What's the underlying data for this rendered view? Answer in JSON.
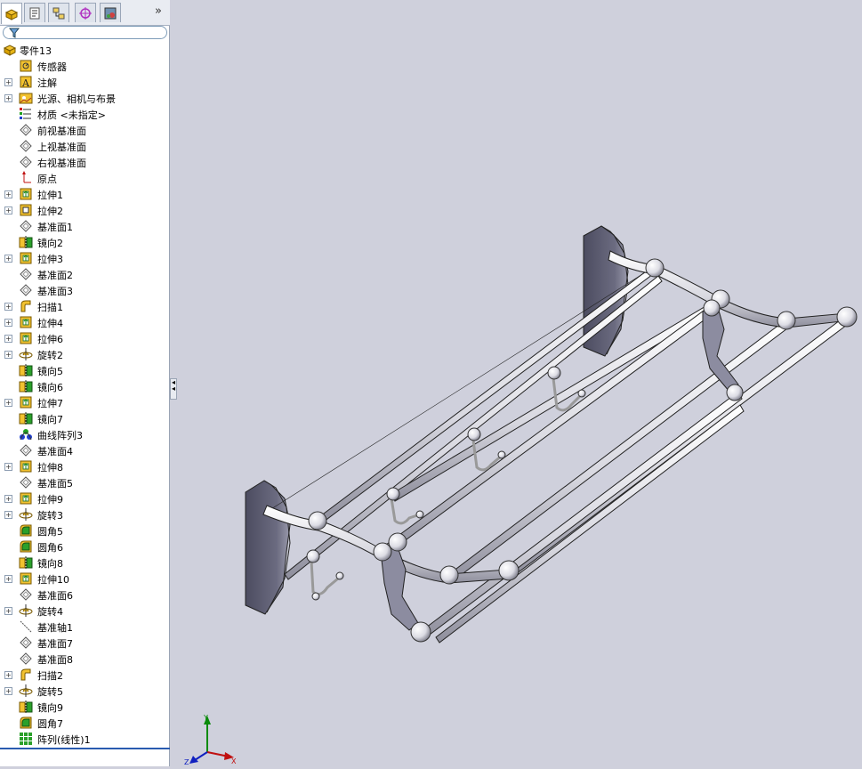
{
  "panel": {
    "tabs": [
      {
        "name": "feature-manager-tab",
        "icon": "feature-tree-icon",
        "active": true
      },
      {
        "name": "property-manager-tab",
        "icon": "property-icon",
        "active": false
      },
      {
        "name": "configuration-manager-tab",
        "icon": "configuration-icon",
        "active": false
      },
      {
        "name": "dim-xpert-tab",
        "icon": "target-icon",
        "active": false
      },
      {
        "name": "display-manager-tab",
        "icon": "display-icon",
        "active": false
      }
    ],
    "more": "»",
    "filter_icon": "filter-icon"
  },
  "tree": {
    "root": {
      "label": "零件13",
      "icon": "part-icon"
    },
    "items": [
      {
        "label": "传感器",
        "icon": "sensor-icon",
        "expandable": false
      },
      {
        "label": "注解",
        "icon": "annotation-icon",
        "expandable": true
      },
      {
        "label": "光源、相机与布景",
        "icon": "lights-icon",
        "expandable": true
      },
      {
        "label": "材质 <未指定>",
        "icon": "material-icon",
        "expandable": false
      },
      {
        "label": "前视基准面",
        "icon": "plane-icon",
        "expandable": false
      },
      {
        "label": "上视基准面",
        "icon": "plane-icon",
        "expandable": false
      },
      {
        "label": "右视基准面",
        "icon": "plane-icon",
        "expandable": false
      },
      {
        "label": "原点",
        "icon": "origin-icon",
        "expandable": false
      },
      {
        "label": "拉伸1",
        "icon": "extrude-icon",
        "expandable": true
      },
      {
        "label": "拉伸2",
        "icon": "extrude-cut-icon",
        "expandable": true
      },
      {
        "label": "基准面1",
        "icon": "plane-icon",
        "expandable": false
      },
      {
        "label": "镜向2",
        "icon": "mirror-icon",
        "expandable": false
      },
      {
        "label": "拉伸3",
        "icon": "extrude-icon",
        "expandable": true
      },
      {
        "label": "基准面2",
        "icon": "plane-icon",
        "expandable": false
      },
      {
        "label": "基准面3",
        "icon": "plane-icon",
        "expandable": false
      },
      {
        "label": "扫描1",
        "icon": "sweep-icon",
        "expandable": true
      },
      {
        "label": "拉伸4",
        "icon": "extrude-icon",
        "expandable": true
      },
      {
        "label": "拉伸6",
        "icon": "extrude-icon",
        "expandable": true
      },
      {
        "label": "旋转2",
        "icon": "revolve-icon",
        "expandable": true
      },
      {
        "label": "镜向5",
        "icon": "mirror-icon",
        "expandable": false
      },
      {
        "label": "镜向6",
        "icon": "mirror-icon",
        "expandable": false
      },
      {
        "label": "拉伸7",
        "icon": "extrude-icon",
        "expandable": true
      },
      {
        "label": "镜向7",
        "icon": "mirror-icon",
        "expandable": false
      },
      {
        "label": "曲线阵列3",
        "icon": "curve-pattern-icon",
        "expandable": false
      },
      {
        "label": "基准面4",
        "icon": "plane-icon",
        "expandable": false
      },
      {
        "label": "拉伸8",
        "icon": "extrude-icon",
        "expandable": true
      },
      {
        "label": "基准面5",
        "icon": "plane-icon",
        "expandable": false
      },
      {
        "label": "拉伸9",
        "icon": "extrude-icon",
        "expandable": true
      },
      {
        "label": "旋转3",
        "icon": "revolve-icon",
        "expandable": true
      },
      {
        "label": "圆角5",
        "icon": "fillet-icon",
        "expandable": false
      },
      {
        "label": "圆角6",
        "icon": "fillet-icon",
        "expandable": false
      },
      {
        "label": "镜向8",
        "icon": "mirror-icon",
        "expandable": false
      },
      {
        "label": "拉伸10",
        "icon": "extrude-icon",
        "expandable": true
      },
      {
        "label": "基准面6",
        "icon": "plane-icon",
        "expandable": false
      },
      {
        "label": "旋转4",
        "icon": "revolve-icon",
        "expandable": true
      },
      {
        "label": "基准轴1",
        "icon": "axis-icon",
        "expandable": false
      },
      {
        "label": "基准面7",
        "icon": "plane-icon",
        "expandable": false
      },
      {
        "label": "基准面8",
        "icon": "plane-icon",
        "expandable": false
      },
      {
        "label": "扫描2",
        "icon": "sweep-icon",
        "expandable": true
      },
      {
        "label": "旋转5",
        "icon": "revolve-icon",
        "expandable": true
      },
      {
        "label": "镜向9",
        "icon": "mirror-icon",
        "expandable": false
      },
      {
        "label": "圆角7",
        "icon": "fillet-icon",
        "expandable": false
      },
      {
        "label": "阵列(线性)1",
        "icon": "linear-pattern-icon",
        "expandable": false
      }
    ]
  },
  "viewport": {
    "model": "towel-rack-model",
    "triad": {
      "x": "X",
      "y": "Y",
      "z": "Z"
    },
    "colors": {
      "background": "#cfd0dc",
      "model_dark": "#5a5a6e",
      "model_light": "#e8e8ee",
      "model_mid": "#a9a9b8"
    }
  }
}
